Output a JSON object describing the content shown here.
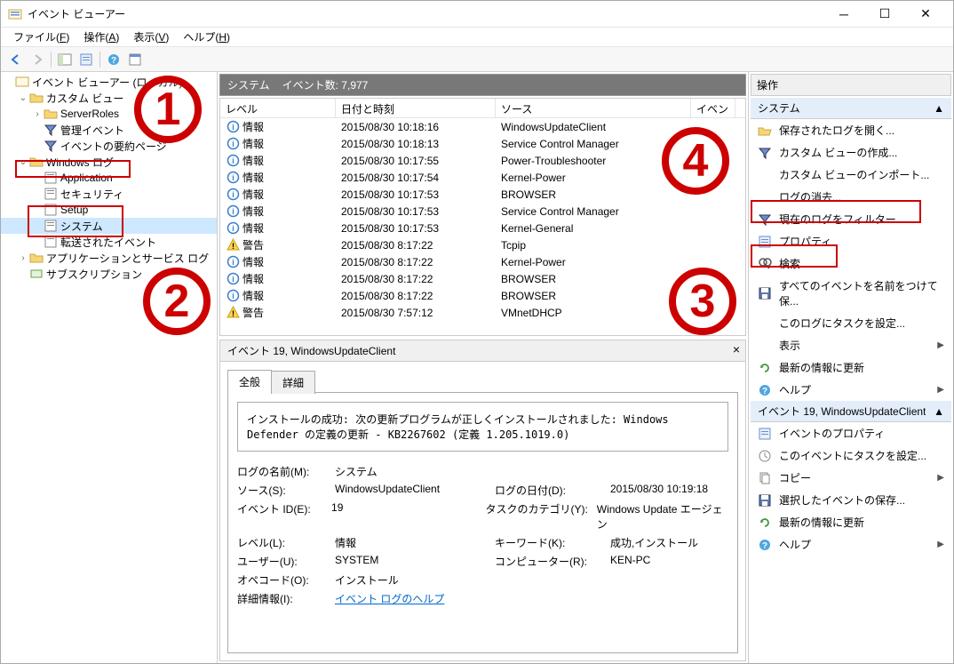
{
  "window": {
    "title": "イベント ビューアー"
  },
  "menubar": [
    {
      "label": "ファイル(",
      "key": "F",
      "end": ")"
    },
    {
      "label": "操作(",
      "key": "A",
      "end": ")"
    },
    {
      "label": "表示(",
      "key": "V",
      "end": ")"
    },
    {
      "label": "ヘルプ(",
      "key": "H",
      "end": ")"
    }
  ],
  "tree": {
    "root": "イベント ビューアー (ローカル)",
    "customview": "カスタム ビュー",
    "serverroles": "ServerRoles",
    "adminEvents": "管理イベント",
    "summaryPage": "イベントの要約ページ",
    "windowsLog": "Windows ログ",
    "application": "Application",
    "security": "セキュリティ",
    "setup": "Setup",
    "system": "システム",
    "forwarded": "転送されたイベント",
    "appservice": "アプリケーションとサービス ログ",
    "subscription": "サブスクリプション"
  },
  "center": {
    "headerTitle": "システム",
    "headerCount": "イベント数: 7,977",
    "columns": {
      "level": "レベル",
      "date": "日付と時刻",
      "source": "ソース",
      "event": "イベン"
    }
  },
  "events": [
    {
      "level": "情報",
      "icon": "info",
      "date": "2015/08/30 10:18:16",
      "source": "WindowsUpdateClient"
    },
    {
      "level": "情報",
      "icon": "info",
      "date": "2015/08/30 10:18:13",
      "source": "Service Control Manager"
    },
    {
      "level": "情報",
      "icon": "info",
      "date": "2015/08/30 10:17:55",
      "source": "Power-Troubleshooter"
    },
    {
      "level": "情報",
      "icon": "info",
      "date": "2015/08/30 10:17:54",
      "source": "Kernel-Power"
    },
    {
      "level": "情報",
      "icon": "info",
      "date": "2015/08/30 10:17:53",
      "source": "BROWSER"
    },
    {
      "level": "情報",
      "icon": "info",
      "date": "2015/08/30 10:17:53",
      "source": "Service Control Manager"
    },
    {
      "level": "情報",
      "icon": "info",
      "date": "2015/08/30 10:17:53",
      "source": "Kernel-General"
    },
    {
      "level": "警告",
      "icon": "warn",
      "date": "2015/08/30 8:17:22",
      "source": "Tcpip"
    },
    {
      "level": "情報",
      "icon": "info",
      "date": "2015/08/30 8:17:22",
      "source": "Kernel-Power"
    },
    {
      "level": "情報",
      "icon": "info",
      "date": "2015/08/30 8:17:22",
      "source": "BROWSER"
    },
    {
      "level": "情報",
      "icon": "info",
      "date": "2015/08/30 8:17:22",
      "source": "BROWSER"
    },
    {
      "level": "警告",
      "icon": "warn",
      "date": "2015/08/30 7:57:12",
      "source": "VMnetDHCP"
    }
  ],
  "detail": {
    "header": "イベント 19, WindowsUpdateClient",
    "tabGeneral": "全般",
    "tabDetail": "詳細",
    "message": "インストールの成功: 次の更新プログラムが正しくインストールされました: Windows Defender の定義の更新 - KB2267602 (定義 1.205.1019.0)",
    "labels": {
      "logName": "ログの名前(M):",
      "logNameVal": "システム",
      "source": "ソース(S):",
      "sourceVal": "WindowsUpdateClient",
      "logDate": "ログの日付(D):",
      "logDateVal": "2015/08/30 10:19:18",
      "eventId": "イベント ID(E):",
      "eventIdVal": "19",
      "taskCat": "タスクのカテゴリ(Y):",
      "taskCatVal": "Windows Update エージェン",
      "level": "レベル(L):",
      "levelVal": "情報",
      "keyword": "キーワード(K):",
      "keywordVal": "成功,インストール",
      "user": "ユーザー(U):",
      "userVal": "SYSTEM",
      "computer": "コンピューター(R):",
      "computerVal": "KEN-PC",
      "opcode": "オペコード(O):",
      "opcodeVal": "インストール",
      "moreInfo": "詳細情報(I):",
      "moreInfoLink": "イベント ログのヘルプ"
    }
  },
  "actions": {
    "header": "操作",
    "section1": "システム",
    "items1": [
      {
        "icon": "folder-open",
        "label": "保存されたログを開く..."
      },
      {
        "icon": "filter",
        "label": "カスタム ビューの作成..."
      },
      {
        "icon": "blank",
        "label": "カスタム ビューのインポート..."
      },
      {
        "icon": "blank",
        "label": "ログの消去..."
      },
      {
        "icon": "filter",
        "label": "現在のログをフィルター..."
      },
      {
        "icon": "props",
        "label": "プロパティ"
      },
      {
        "icon": "search",
        "label": "検索..."
      },
      {
        "icon": "save",
        "label": "すべてのイベントを名前をつけて保..."
      },
      {
        "icon": "blank",
        "label": "このログにタスクを設定..."
      },
      {
        "icon": "blank",
        "label": "表示",
        "arrow": true
      },
      {
        "icon": "refresh",
        "label": "最新の情報に更新"
      },
      {
        "icon": "help",
        "label": "ヘルプ",
        "arrow": true
      }
    ],
    "section2": "イベント 19, WindowsUpdateClient",
    "items2": [
      {
        "icon": "props",
        "label": "イベントのプロパティ"
      },
      {
        "icon": "task",
        "label": "このイベントにタスクを設定..."
      },
      {
        "icon": "copy",
        "label": "コピー",
        "arrow": true
      },
      {
        "icon": "save",
        "label": "選択したイベントの保存..."
      },
      {
        "icon": "refresh",
        "label": "最新の情報に更新"
      },
      {
        "icon": "help",
        "label": "ヘルプ",
        "arrow": true
      }
    ]
  },
  "annotations": {
    "n1": "1",
    "n2": "2",
    "n3": "3",
    "n4": "4"
  }
}
